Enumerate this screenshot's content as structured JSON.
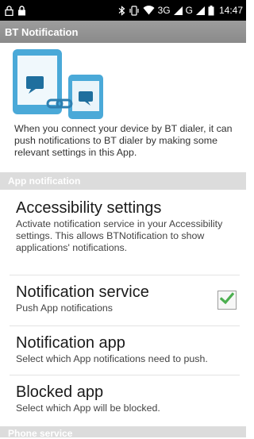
{
  "status_bar": {
    "network": "3G",
    "network2": "G",
    "time": "14:47",
    "icons": [
      "lock-outline-icon",
      "lock-icon",
      "bluetooth-icon",
      "vibrate-icon",
      "wifi-icon",
      "signal-icon",
      "signal-icon",
      "battery-icon"
    ]
  },
  "app_bar": {
    "title": "BT Notification"
  },
  "hero": {
    "icon": "phone-link-illustration-icon",
    "colors": {
      "device": "#4aa9d8",
      "bubble": "#1f6f9e"
    }
  },
  "intro": {
    "text": "When you connect your device by BT dialer, it can push notifications to BT dialer by making some relevant settings in this App."
  },
  "sections": {
    "app_notification": {
      "label": "App notification"
    },
    "phone_service": {
      "label": "Phone service"
    }
  },
  "prefs": {
    "accessibility": {
      "title": "Accessibility settings",
      "summary": "Activate notification service in your Accessibility settings. This allows BTNotification to show applications' notifications."
    },
    "notification_service": {
      "title": "Notification service",
      "summary": "Push App notifications",
      "checked": true
    },
    "notification_app": {
      "title": "Notification app",
      "summary": "Select which App notifications need to push."
    },
    "blocked_app": {
      "title": "Blocked app",
      "summary": "Select which App will be blocked."
    }
  },
  "colors": {
    "accent": "#4caf50",
    "section_bg": "#dcdcdc",
    "action_bar": "#939393"
  }
}
